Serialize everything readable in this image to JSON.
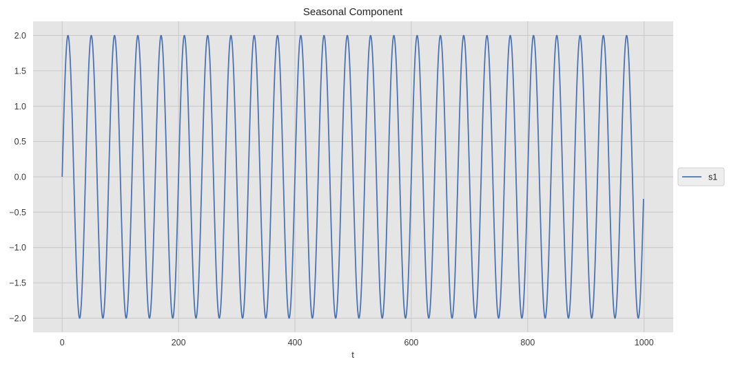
{
  "chart_data": {
    "type": "line",
    "title": "Seasonal Component",
    "xlabel": "t",
    "ylabel": "",
    "xlim": [
      -50,
      1050
    ],
    "ylim": [
      -2.2,
      2.2
    ],
    "x_ticks": [
      0,
      200,
      400,
      600,
      800,
      1000
    ],
    "x_tick_labels": [
      "0",
      "200",
      "400",
      "600",
      "800",
      "1000"
    ],
    "y_ticks": [
      2.0,
      1.5,
      1.0,
      0.5,
      0.0,
      -0.5,
      -1.0,
      -1.5,
      -2.0
    ],
    "y_tick_labels": [
      "2.0",
      "1.5",
      "1.0",
      "0.5",
      "0.0",
      "−0.5",
      "−1.0",
      "−1.5",
      "−2.0"
    ],
    "grid": true,
    "legend_position": "right-center",
    "background_color": "#e5e5e5",
    "grid_color": "#c8c8c8",
    "series": [
      {
        "name": "s1",
        "color": "#4c72b0",
        "function": "2*sin(2*pi*t/40)",
        "amplitude": 2,
        "period": 40,
        "x_start": 0,
        "x_end": 999,
        "start_value": 0.0,
        "end_value": -0.31
      }
    ]
  }
}
